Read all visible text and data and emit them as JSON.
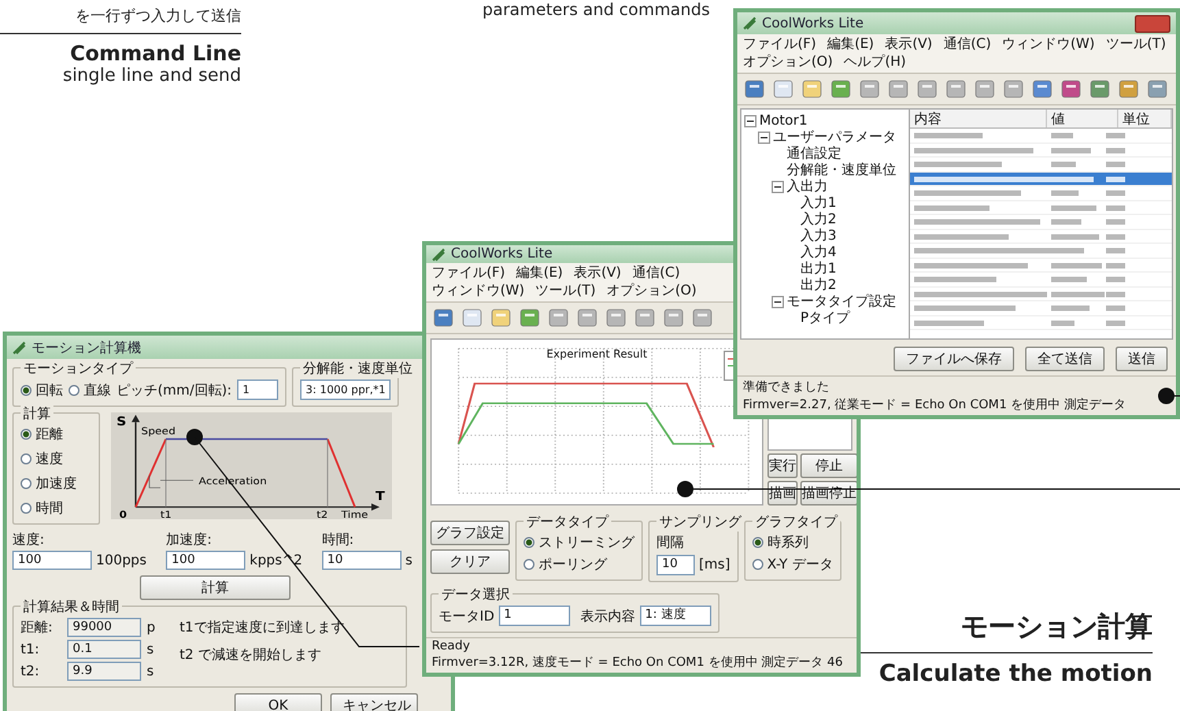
{
  "command_line_caption": {
    "japanese": "を一行ずつ入力して送信",
    "title": "Command Line",
    "subtitle": "single line and send"
  },
  "parameters_caption": {
    "subtitle": "parameters and commands"
  },
  "settings_window": {
    "title": "CoolWorks Lite",
    "menu": [
      "ファイル(F)",
      "編集(E)",
      "表示(V)",
      "通信(C)",
      "ウィンドウ(W)",
      "ツール(T)",
      "オプション(O)",
      "ヘルプ(H)"
    ],
    "tree": [
      {
        "label": "Motor1",
        "expanded": true,
        "children": [
          {
            "label": "ユーザーパラメータ",
            "expanded": true,
            "children": [
              {
                "label": "通信設定"
              },
              {
                "label": "分解能・速度単位"
              },
              {
                "label": "入出力",
                "expanded": true,
                "children": [
                  {
                    "label": "入力1"
                  },
                  {
                    "label": "入力2"
                  },
                  {
                    "label": "入力3"
                  },
                  {
                    "label": "入力4"
                  },
                  {
                    "label": "出力1"
                  },
                  {
                    "label": "出力2"
                  }
                ]
              },
              {
                "label": "モータタイプ設定",
                "expanded": true,
                "children": [
                  {
                    "label": "Pタイプ"
                  }
                ]
              }
            ]
          }
        ]
      }
    ],
    "columns": [
      "内容",
      "値",
      "単位"
    ],
    "rows": [
      {
        "selected": false
      },
      {
        "selected": false
      },
      {
        "selected": false
      },
      {
        "selected": true
      },
      {
        "selected": false
      },
      {
        "selected": false
      },
      {
        "selected": false
      },
      {
        "selected": false
      },
      {
        "selected": false
      },
      {
        "selected": false
      },
      {
        "selected": false
      },
      {
        "selected": false
      },
      {
        "selected": false
      },
      {
        "selected": false
      }
    ],
    "buttons": [
      "ファイルへ保存",
      "全て送信",
      "送信"
    ],
    "status": "準備できました",
    "status_info": "Firmver=2.27, 従業モード = Echo On COM1 を使用中 測定データ"
  },
  "graph_window": {
    "title": "CoolWorks Lite",
    "menu": [
      "ファイル(F)",
      "編集(E)",
      "表示(V)",
      "通信(C)",
      "ウィンドウ(W)",
      "ツール(T)",
      "オプション(O)"
    ],
    "chart_title": "Experiment Result",
    "panel_buttons": [
      "実行",
      "停止",
      "描画",
      "描画停止"
    ],
    "graph_buttons": [
      "グラフ設定",
      "クリア"
    ],
    "data_type": {
      "label": "データタイプ",
      "options": [
        {
          "label": "ストリーミング",
          "selected": true
        },
        {
          "label": "ポーリング",
          "selected": false
        }
      ]
    },
    "sampling": {
      "label": "サンプリング",
      "sublabel": "間隔",
      "value": "10",
      "unit": "[ms]"
    },
    "graph_type": {
      "label": "グラフタイプ",
      "options": [
        {
          "label": "時系列",
          "selected": true
        },
        {
          "label": "X-Y データ",
          "selected": false
        }
      ]
    },
    "data_select": {
      "label": "データ選択",
      "fields": [
        {
          "label": "モータID",
          "value": "1"
        },
        {
          "label": "表示内容",
          "value": "1: 速度"
        }
      ]
    },
    "status": "Ready",
    "status_info": "Firmver=3.12R, 速度モード = Echo On COM1 を使用中 測定データ 46"
  },
  "calc_window": {
    "title": "モーション計算機",
    "motion_type": {
      "label": "モーションタイプ",
      "options": [
        {
          "label": "回転",
          "selected": true
        },
        {
          "label": "直線",
          "selected": false
        }
      ],
      "pitch_label": "ピッチ(mm/回転):",
      "pitch": "1"
    },
    "resolution": {
      "label": "分解能・速度単位",
      "value": "3: 1000 ppr,*1"
    },
    "calc": {
      "label": "計算",
      "options": [
        {
          "label": "距離",
          "selected": true
        },
        {
          "label": "速度",
          "selected": false
        },
        {
          "label": "加速度",
          "selected": false
        },
        {
          "label": "時間",
          "selected": false
        }
      ]
    },
    "diagram": {
      "y_axis": "S",
      "speed": "Speed",
      "acceleration": "Acceleration",
      "x_axis": "T",
      "origin": "0",
      "t1": "t1",
      "t2": "t2",
      "time": "Time"
    },
    "inputs": [
      {
        "label": "速度:",
        "value": "100",
        "unit": "100pps"
      },
      {
        "label": "加速度:",
        "value": "100",
        "unit": "kpps^2"
      },
      {
        "label": "時間:",
        "value": "10",
        "unit": "s"
      }
    ],
    "calc_button": "計算",
    "results": {
      "label": "計算結果＆時間",
      "rows": [
        {
          "label": "距離:",
          "value": "99000",
          "unit": "p"
        },
        {
          "label": "t1:",
          "value": "0.1",
          "unit": "s"
        },
        {
          "label": "t2:",
          "value": "9.9",
          "unit": "s"
        }
      ],
      "notes": [
        "t1で指定速度に到達します",
        "t2 で減速を開始します"
      ]
    },
    "buttons": [
      "OK",
      "キャンセル"
    ]
  },
  "motion_caption": {
    "title": "モーション計算",
    "subtitle": "Calculate the motion"
  }
}
